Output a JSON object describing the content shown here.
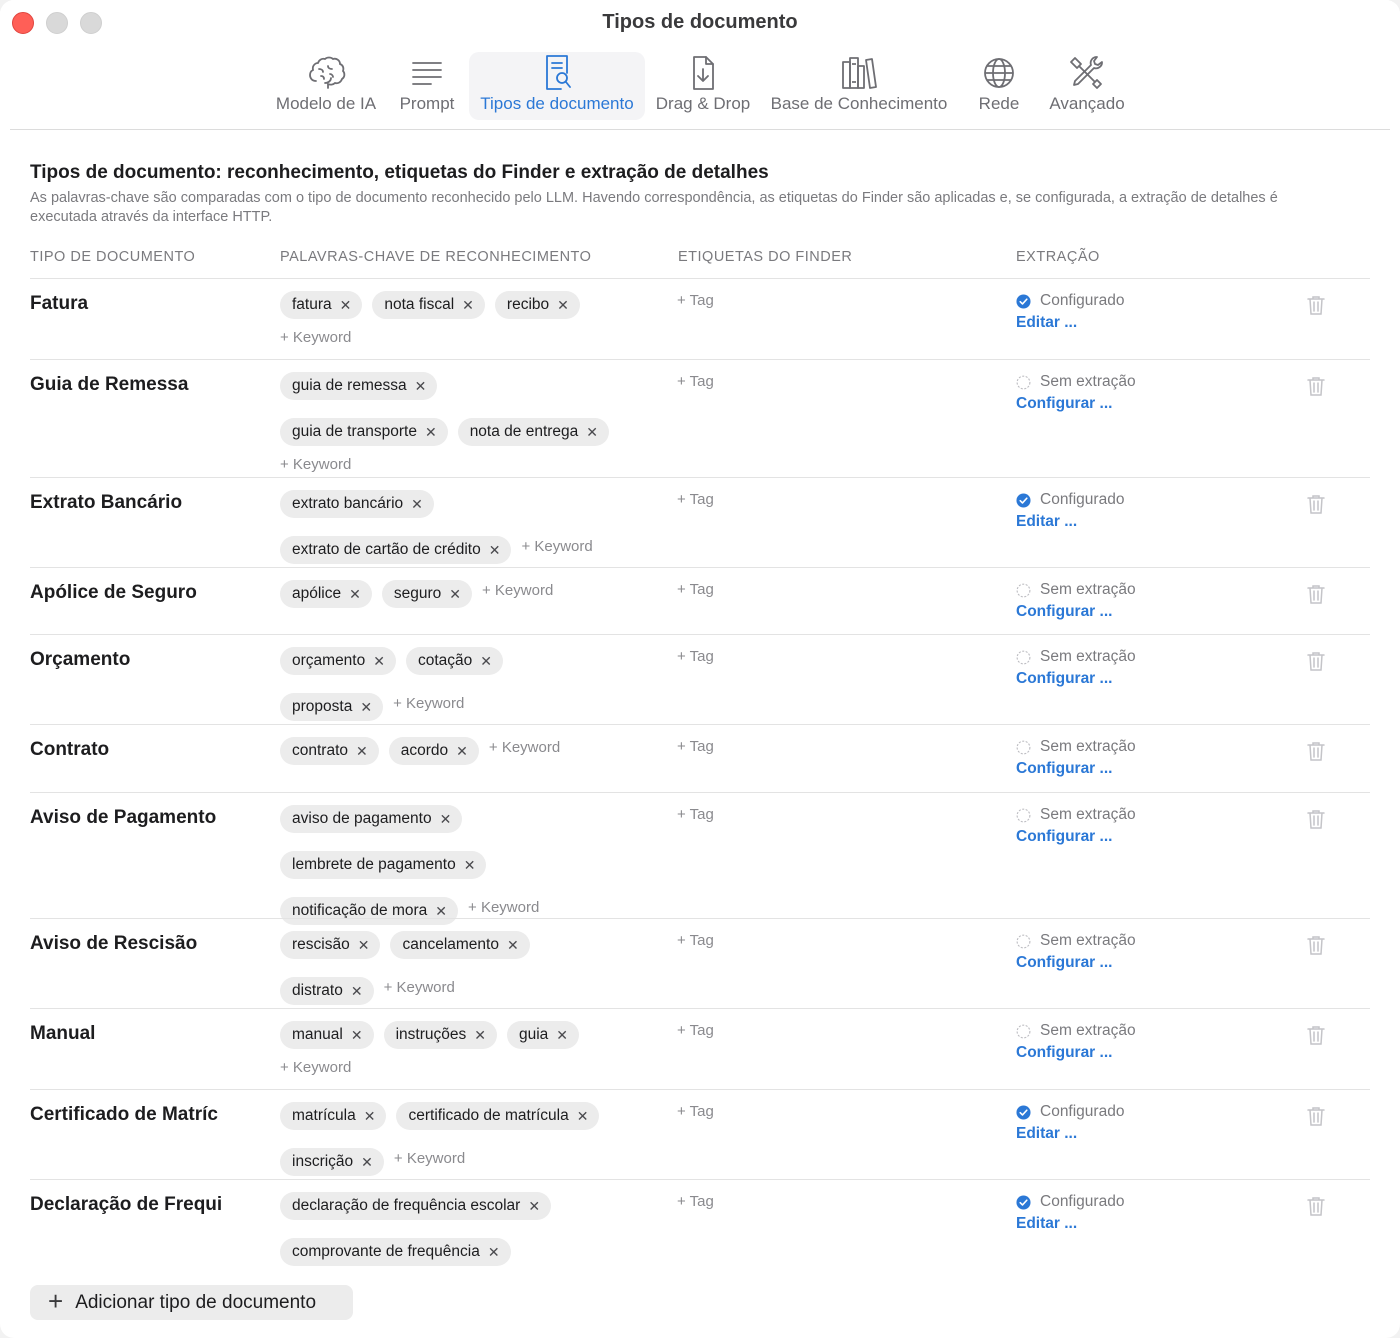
{
  "window": {
    "title": "Tipos de documento"
  },
  "toolbar": {
    "items": [
      {
        "label": "Modelo de IA",
        "icon": "brain-icon"
      },
      {
        "label": "Prompt",
        "icon": "text-lines-icon"
      },
      {
        "label": "Tipos de documento",
        "icon": "document-search-icon",
        "active": true
      },
      {
        "label": "Drag & Drop",
        "icon": "document-download-icon"
      },
      {
        "label": "Base de Conhecimento",
        "icon": "books-icon"
      },
      {
        "label": "Rede",
        "icon": "globe-icon"
      },
      {
        "label": "Avançado",
        "icon": "tools-icon"
      }
    ]
  },
  "section": {
    "title": "Tipos de documento: reconhecimento, etiquetas do Finder e extração de detalhes",
    "description": "As palavras-chave são comparadas com o tipo de documento reconhecido pelo LLM. Havendo correspondência, as etiquetas do Finder são aplicadas e, se configurada, a extração de detalhes é executada através da interface HTTP."
  },
  "columns": {
    "doc_type": "TIPO DE DOCUMENTO",
    "keywords": "PALAVRAS-CHAVE DE RECONHECIMENTO",
    "finder_tags": "ETIQUETAS DO FINDER",
    "extraction": "EXTRAÇÃO"
  },
  "labels": {
    "add_keyword": "+ Keyword",
    "add_tag": "+ Tag",
    "remove_symbol": "✕",
    "status_configured": "Configurado",
    "status_none": "Sem extração",
    "link_edit": "Editar ...",
    "link_configure": "Configurar ..."
  },
  "colors": {
    "accent": "#2b78d6",
    "close": "#ff5f57",
    "chip": "#ececec"
  },
  "rows": [
    {
      "name": "Fatura",
      "keywords": [
        "fatura",
        "nota fiscal",
        "recibo"
      ],
      "configured": true
    },
    {
      "name": "Guia de Remessa",
      "keywords": [
        "guia de remessa",
        "guia de transporte",
        "nota de entrega"
      ],
      "configured": false
    },
    {
      "name": "Extrato Bancário",
      "keywords": [
        "extrato bancário",
        "extrato de cartão de crédito"
      ],
      "configured": true
    },
    {
      "name": "Apólice de Seguro",
      "keywords": [
        "apólice",
        "seguro"
      ],
      "configured": false
    },
    {
      "name": "Orçamento",
      "keywords": [
        "orçamento",
        "cotação",
        "proposta"
      ],
      "configured": false
    },
    {
      "name": "Contrato",
      "keywords": [
        "contrato",
        "acordo"
      ],
      "configured": false
    },
    {
      "name": "Aviso de Pagamento",
      "keywords": [
        "aviso de pagamento",
        "lembrete de pagamento",
        "notificação de mora"
      ],
      "configured": false
    },
    {
      "name": "Aviso de Rescisão",
      "keywords": [
        "rescisão",
        "cancelamento",
        "distrato"
      ],
      "configured": false
    },
    {
      "name": "Manual",
      "keywords": [
        "manual",
        "instruções",
        "guia"
      ],
      "configured": false
    },
    {
      "name": "Certificado de Matríc",
      "keywords": [
        "matrícula",
        "certificado de matrícula",
        "inscrição"
      ],
      "configured": true
    },
    {
      "name": "Declaração de Frequi",
      "keywords": [
        "declaração de frequência escolar",
        "comprovante de frequência"
      ],
      "configured": true
    }
  ],
  "footer": {
    "add_button": "Adicionar tipo de documento"
  }
}
